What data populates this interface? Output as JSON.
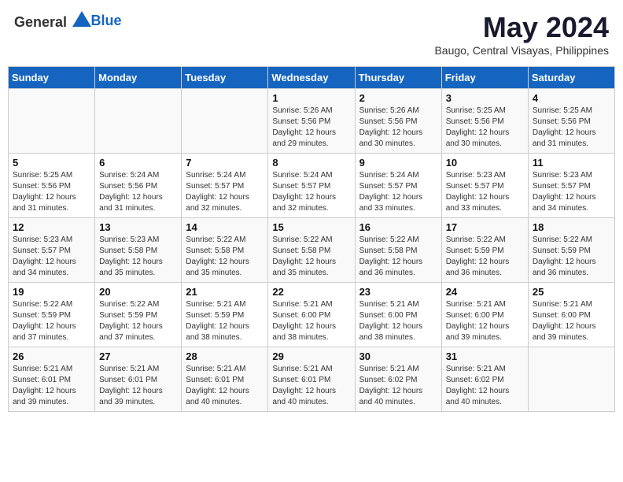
{
  "header": {
    "logo_general": "General",
    "logo_blue": "Blue",
    "title": "May 2024",
    "subtitle": "Baugo, Central Visayas, Philippines"
  },
  "days_of_week": [
    "Sunday",
    "Monday",
    "Tuesday",
    "Wednesday",
    "Thursday",
    "Friday",
    "Saturday"
  ],
  "weeks": [
    [
      {
        "day": "",
        "info": ""
      },
      {
        "day": "",
        "info": ""
      },
      {
        "day": "",
        "info": ""
      },
      {
        "day": "1",
        "info": "Sunrise: 5:26 AM\nSunset: 5:56 PM\nDaylight: 12 hours\nand 29 minutes."
      },
      {
        "day": "2",
        "info": "Sunrise: 5:26 AM\nSunset: 5:56 PM\nDaylight: 12 hours\nand 30 minutes."
      },
      {
        "day": "3",
        "info": "Sunrise: 5:25 AM\nSunset: 5:56 PM\nDaylight: 12 hours\nand 30 minutes."
      },
      {
        "day": "4",
        "info": "Sunrise: 5:25 AM\nSunset: 5:56 PM\nDaylight: 12 hours\nand 31 minutes."
      }
    ],
    [
      {
        "day": "5",
        "info": "Sunrise: 5:25 AM\nSunset: 5:56 PM\nDaylight: 12 hours\nand 31 minutes."
      },
      {
        "day": "6",
        "info": "Sunrise: 5:24 AM\nSunset: 5:56 PM\nDaylight: 12 hours\nand 31 minutes."
      },
      {
        "day": "7",
        "info": "Sunrise: 5:24 AM\nSunset: 5:57 PM\nDaylight: 12 hours\nand 32 minutes."
      },
      {
        "day": "8",
        "info": "Sunrise: 5:24 AM\nSunset: 5:57 PM\nDaylight: 12 hours\nand 32 minutes."
      },
      {
        "day": "9",
        "info": "Sunrise: 5:24 AM\nSunset: 5:57 PM\nDaylight: 12 hours\nand 33 minutes."
      },
      {
        "day": "10",
        "info": "Sunrise: 5:23 AM\nSunset: 5:57 PM\nDaylight: 12 hours\nand 33 minutes."
      },
      {
        "day": "11",
        "info": "Sunrise: 5:23 AM\nSunset: 5:57 PM\nDaylight: 12 hours\nand 34 minutes."
      }
    ],
    [
      {
        "day": "12",
        "info": "Sunrise: 5:23 AM\nSunset: 5:57 PM\nDaylight: 12 hours\nand 34 minutes."
      },
      {
        "day": "13",
        "info": "Sunrise: 5:23 AM\nSunset: 5:58 PM\nDaylight: 12 hours\nand 35 minutes."
      },
      {
        "day": "14",
        "info": "Sunrise: 5:22 AM\nSunset: 5:58 PM\nDaylight: 12 hours\nand 35 minutes."
      },
      {
        "day": "15",
        "info": "Sunrise: 5:22 AM\nSunset: 5:58 PM\nDaylight: 12 hours\nand 35 minutes."
      },
      {
        "day": "16",
        "info": "Sunrise: 5:22 AM\nSunset: 5:58 PM\nDaylight: 12 hours\nand 36 minutes."
      },
      {
        "day": "17",
        "info": "Sunrise: 5:22 AM\nSunset: 5:59 PM\nDaylight: 12 hours\nand 36 minutes."
      },
      {
        "day": "18",
        "info": "Sunrise: 5:22 AM\nSunset: 5:59 PM\nDaylight: 12 hours\nand 36 minutes."
      }
    ],
    [
      {
        "day": "19",
        "info": "Sunrise: 5:22 AM\nSunset: 5:59 PM\nDaylight: 12 hours\nand 37 minutes."
      },
      {
        "day": "20",
        "info": "Sunrise: 5:22 AM\nSunset: 5:59 PM\nDaylight: 12 hours\nand 37 minutes."
      },
      {
        "day": "21",
        "info": "Sunrise: 5:21 AM\nSunset: 5:59 PM\nDaylight: 12 hours\nand 38 minutes."
      },
      {
        "day": "22",
        "info": "Sunrise: 5:21 AM\nSunset: 6:00 PM\nDaylight: 12 hours\nand 38 minutes."
      },
      {
        "day": "23",
        "info": "Sunrise: 5:21 AM\nSunset: 6:00 PM\nDaylight: 12 hours\nand 38 minutes."
      },
      {
        "day": "24",
        "info": "Sunrise: 5:21 AM\nSunset: 6:00 PM\nDaylight: 12 hours\nand 39 minutes."
      },
      {
        "day": "25",
        "info": "Sunrise: 5:21 AM\nSunset: 6:00 PM\nDaylight: 12 hours\nand 39 minutes."
      }
    ],
    [
      {
        "day": "26",
        "info": "Sunrise: 5:21 AM\nSunset: 6:01 PM\nDaylight: 12 hours\nand 39 minutes."
      },
      {
        "day": "27",
        "info": "Sunrise: 5:21 AM\nSunset: 6:01 PM\nDaylight: 12 hours\nand 39 minutes."
      },
      {
        "day": "28",
        "info": "Sunrise: 5:21 AM\nSunset: 6:01 PM\nDaylight: 12 hours\nand 40 minutes."
      },
      {
        "day": "29",
        "info": "Sunrise: 5:21 AM\nSunset: 6:01 PM\nDaylight: 12 hours\nand 40 minutes."
      },
      {
        "day": "30",
        "info": "Sunrise: 5:21 AM\nSunset: 6:02 PM\nDaylight: 12 hours\nand 40 minutes."
      },
      {
        "day": "31",
        "info": "Sunrise: 5:21 AM\nSunset: 6:02 PM\nDaylight: 12 hours\nand 40 minutes."
      },
      {
        "day": "",
        "info": ""
      }
    ]
  ]
}
